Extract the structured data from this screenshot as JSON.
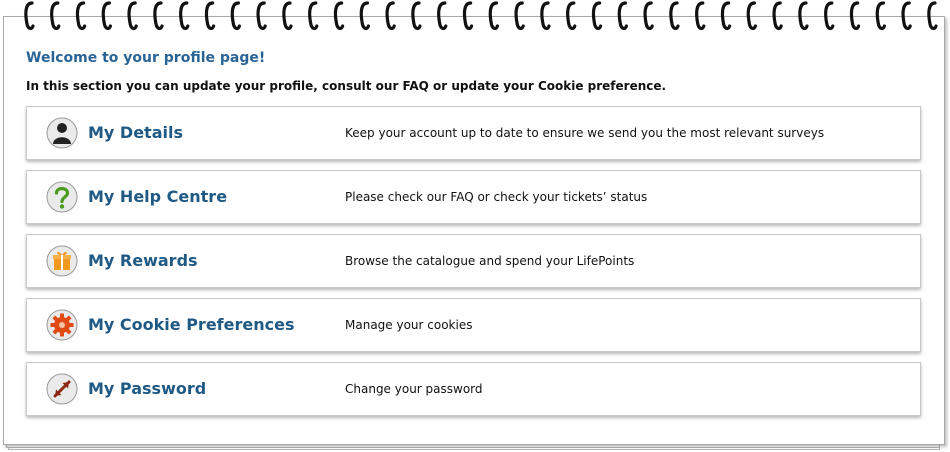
{
  "header": {
    "welcome": "Welcome to your profile page!",
    "intro": "In this section you can update your profile, consult our FAQ or update your Cookie preference."
  },
  "cards": [
    {
      "title": "My Details",
      "desc": "Keep your account up to date to ensure we send you the most relevant surveys",
      "icon": "user-icon"
    },
    {
      "title": "My Help Centre",
      "desc": "Please check our FAQ or check your tickets’ status",
      "icon": "question-mark-icon"
    },
    {
      "title": "My Rewards",
      "desc": "Browse the catalogue and spend your LifePoints",
      "icon": "gift-icon"
    },
    {
      "title": "My Cookie Preferences",
      "desc": "Manage your cookies",
      "icon": "cog-icon"
    },
    {
      "title": "My Password",
      "desc": "Change your password",
      "icon": "key-arrow-icon"
    }
  ],
  "colors": {
    "heading": "#2a6496",
    "card_title": "#1f5a85",
    "help_green": "#4a9a1e",
    "rewards_orange": "#f39a1e",
    "cookie_red": "#e14a12",
    "password_brown": "#8a2a12"
  }
}
